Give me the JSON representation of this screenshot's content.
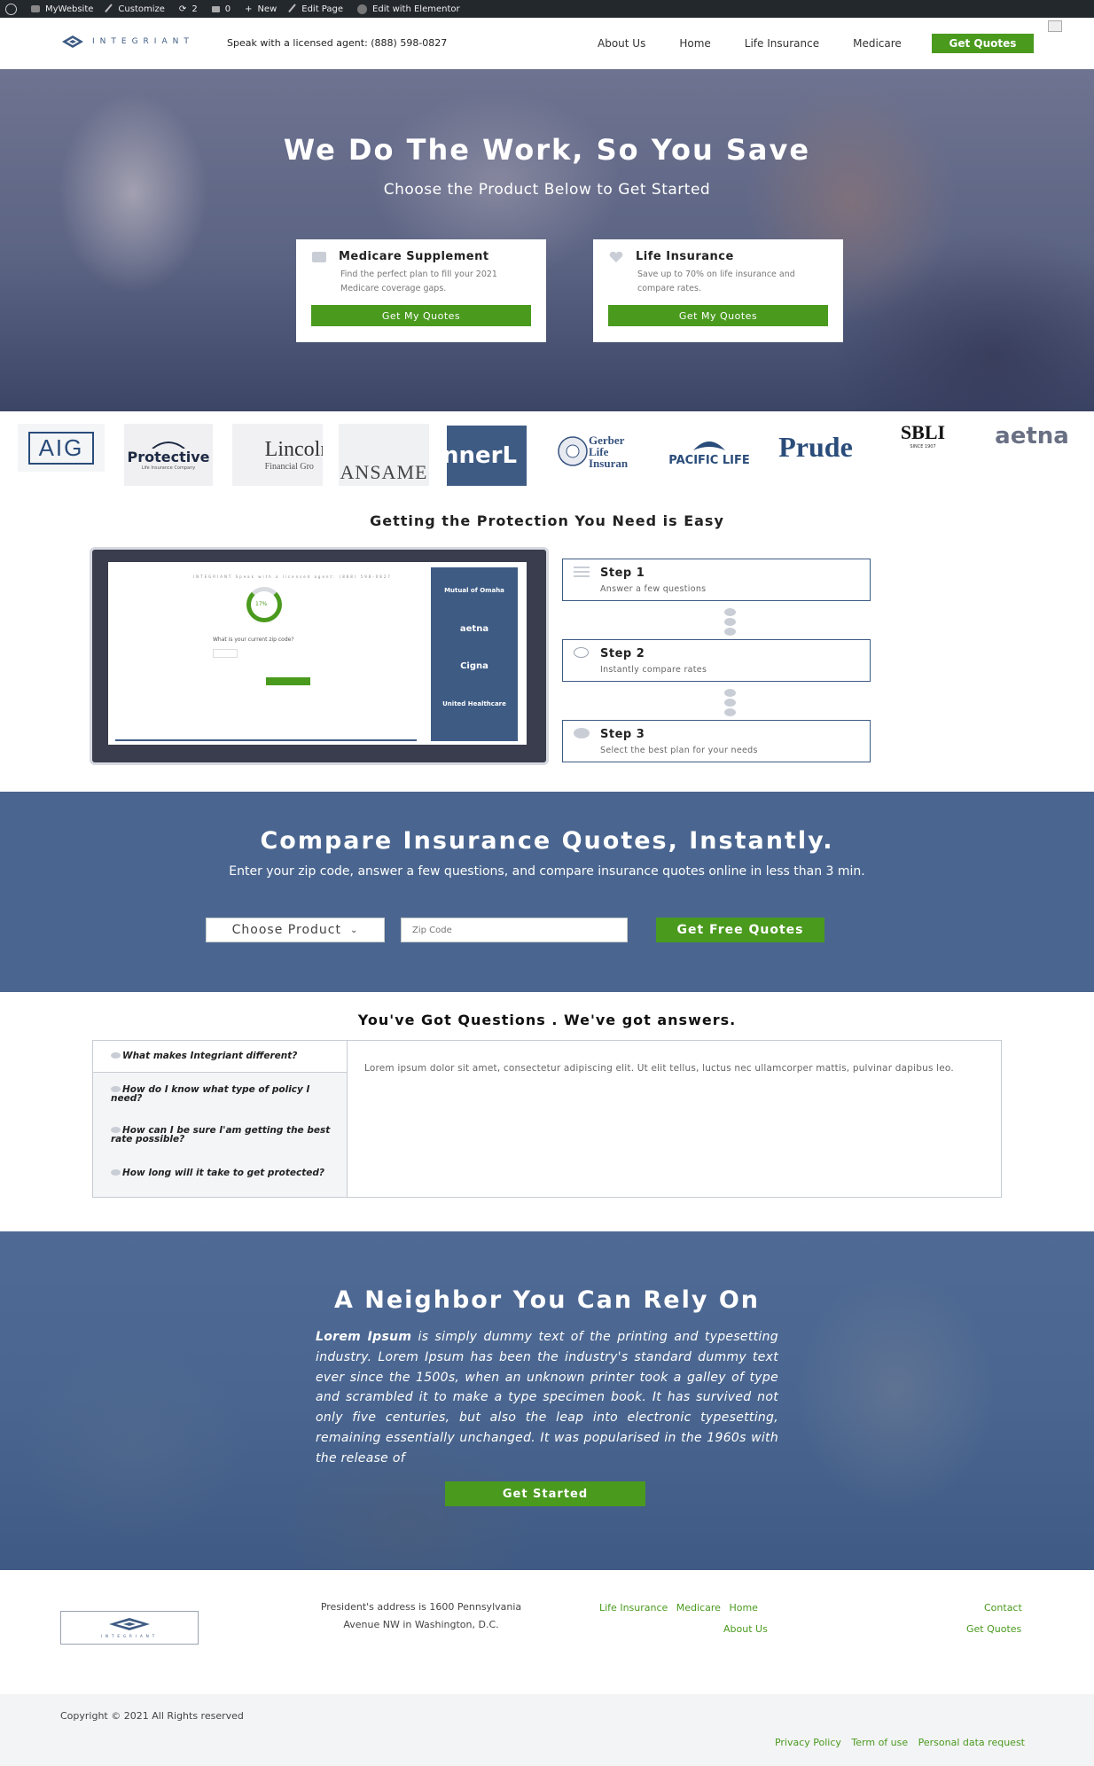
{
  "admin_bar": {
    "site": "MyWebsite",
    "customize": "Customize",
    "updates": "2",
    "comments": "0",
    "new": "New",
    "edit_page": "Edit Page",
    "edit_elementor": "Edit with Elementor"
  },
  "header": {
    "logo_text": "INTEGRIANT",
    "agent": "Speak with a licensed agent: (888) 598-0827",
    "nav": [
      "About Us",
      "Home",
      "Life Insurance",
      "Medicare"
    ],
    "cta": "Get Quotes"
  },
  "hero": {
    "title": "We Do The Work, So You Save",
    "subtitle": "Choose the Product Below to Get Started",
    "cards": [
      {
        "title": "Medicare Supplement",
        "desc": "Find the perfect plan to fill your 2021 Medicare coverage gaps.",
        "button": "Get My Quotes",
        "icon": "card-icon"
      },
      {
        "title": "Life Insurance",
        "desc": "Save up to 70% on life insurance and compare rates.",
        "button": "Get My Quotes",
        "icon": "heart-icon"
      }
    ]
  },
  "logos": {
    "aig": "AIG",
    "protective": "Protective",
    "protective_sub": "Life Insurance Company",
    "lincoln": "Lincoln",
    "lincoln_sub": "Financial Gro",
    "transamerica": "ANSAME",
    "banner": "nnerL",
    "gerber": "Gerber Life Insuran",
    "pacific": "PACIFIC LIFE",
    "prudential": "Prude",
    "sbli": "SBLI",
    "sbli_sub": "SINCE 1907",
    "aetna": "aetna"
  },
  "steps_section": {
    "title": "Getting the Protection You Need is Easy",
    "tablet": {
      "head": "INTEGRIANT   Speak with a licensed agent: (888) 598-0827",
      "progress": "17%",
      "question": "What is your current zip code?",
      "side_logos": [
        "Mutual of Omaha",
        "aetna",
        "Cigna",
        "United Healthcare"
      ]
    },
    "steps": [
      {
        "title": "Step 1",
        "desc": "Answer a few questions"
      },
      {
        "title": "Step 2",
        "desc": "Instantly compare rates"
      },
      {
        "title": "Step 3",
        "desc": "Select the best plan for your needs"
      }
    ]
  },
  "compare": {
    "title": "Compare Insurance Quotes, Instantly.",
    "subtitle": "Enter your zip code, answer a few questions, and compare insurance quotes online in less than 3 min.",
    "select_label": "Choose Product",
    "zip_placeholder": "Zip Code",
    "button": "Get Free Quotes"
  },
  "faq": {
    "title": "You've Got Questions . We've got answers.",
    "questions": [
      "What makes Integriant different?",
      "How do I know what type of policy I need?",
      "How can I be sure I'am getting the best rate possible?",
      "How long will it take to get protected?"
    ],
    "answer": "Lorem ipsum dolor sit amet, consectetur adipiscing elit. Ut elit tellus, luctus nec ullamcorper mattis, pulvinar dapibus leo."
  },
  "neighbor": {
    "title": "A Neighbor You Can Rely On",
    "lead": "Lorem Ipsum",
    "text": " is simply dummy text of the printing and typesetting industry. Lorem Ipsum has been the industry's standard dummy text ever since the 1500s, when an unknown printer took a galley of type and scrambled it to make a type specimen book. It has survived not only five centuries, but also the leap into electronic typesetting, remaining essentially unchanged. It was popularised in the 1960s with the release of",
    "button": "Get Started"
  },
  "footer": {
    "logo_text": "INTEGRIANT",
    "address": "President's address is 1600 Pennsylvania Avenue NW in Washington, D.C.",
    "links": [
      "Life Insurance",
      "Medicare",
      "Home"
    ],
    "about": "About Us",
    "contact": "Contact",
    "quotes": "Get Quotes",
    "copyright": "Copyright © 2021 All Rights reserved",
    "legal": [
      "Privacy Policy",
      "Term of use",
      "Personal data request"
    ]
  },
  "colors": {
    "primary_blue": "#4a6690",
    "dark_blue": "#3e5b84",
    "accent_green": "#4a9a1e",
    "admin_bar": "#23282d"
  }
}
